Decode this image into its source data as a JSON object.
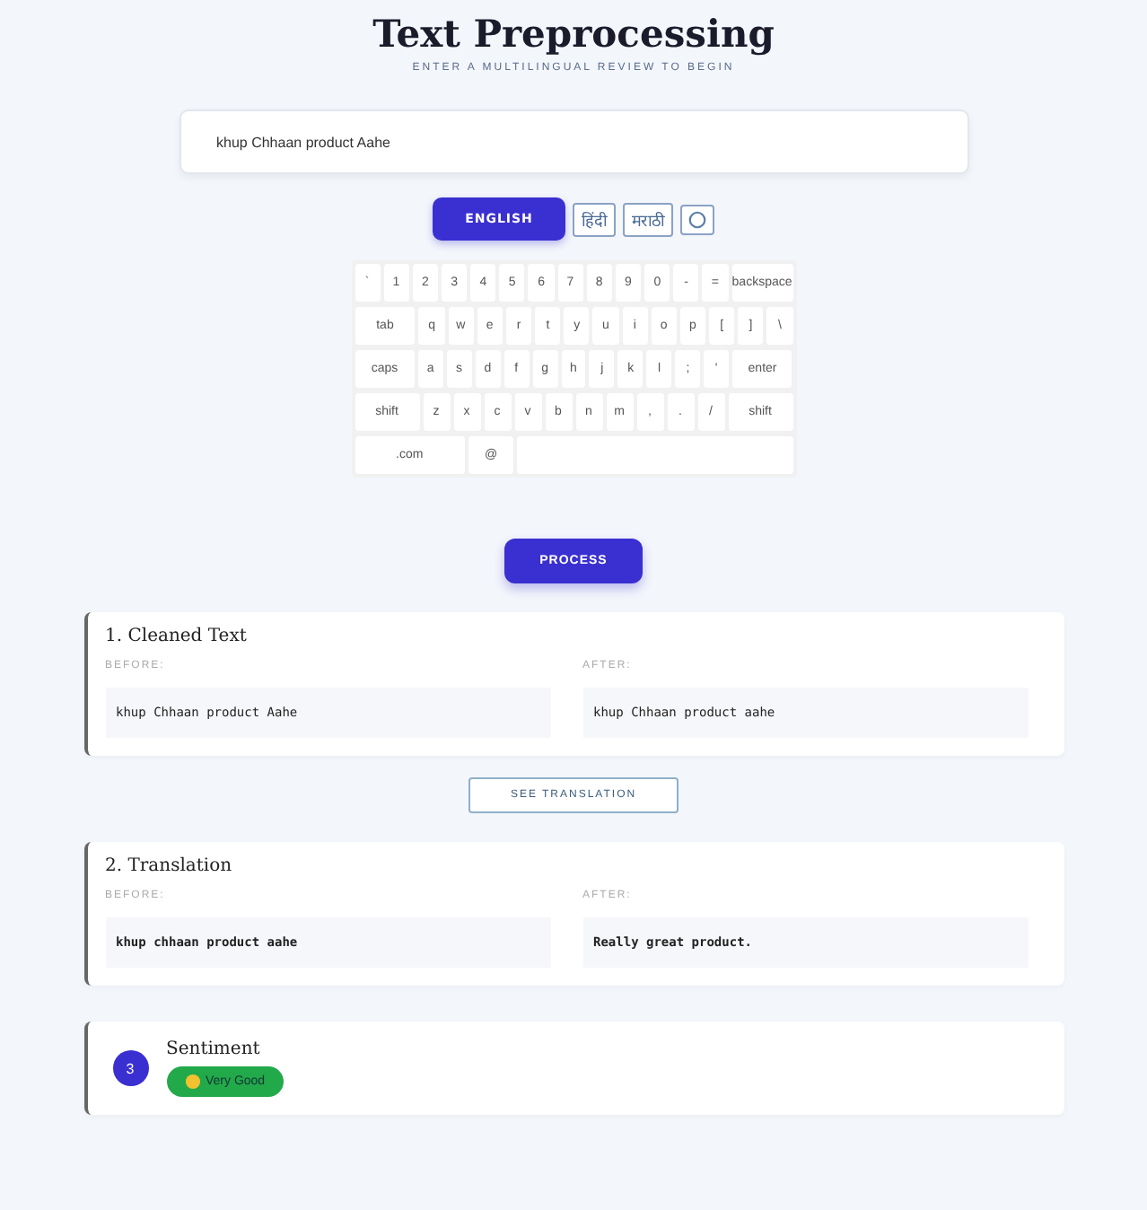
{
  "header": {
    "title": "Text Preprocessing",
    "subtitle": "ENTER A MULTILINGUAL REVIEW TO BEGIN"
  },
  "input": {
    "value": "khup Chhaan product Aahe"
  },
  "languages": [
    {
      "label": "ENGLISH",
      "selected": true
    },
    {
      "label": "हिंदी",
      "selected": false
    },
    {
      "label": "मराठी",
      "selected": false
    }
  ],
  "keyboard": {
    "rows": [
      {
        "keys": [
          "`",
          "1",
          "2",
          "3",
          "4",
          "5",
          "6",
          "7",
          "8",
          "9",
          "0",
          "-",
          "=",
          "backspace"
        ]
      },
      {
        "keys": [
          "tab",
          "q",
          "w",
          "e",
          "r",
          "t",
          "y",
          "u",
          "i",
          "o",
          "p",
          "[",
          "]",
          "\\"
        ]
      },
      {
        "keys": [
          "caps",
          "a",
          "s",
          "d",
          "f",
          "g",
          "h",
          "j",
          "k",
          "l",
          ";",
          "'",
          "enter"
        ]
      },
      {
        "keys": [
          "shift",
          "z",
          "x",
          "c",
          "v",
          "b",
          "n",
          "m",
          ",",
          ".",
          "/",
          "shift"
        ]
      },
      {
        "keys": [
          ".com",
          "@"
        ]
      }
    ]
  },
  "process_button": "PROCESS",
  "cleaned": {
    "title": "1. Cleaned Text",
    "before_label": "BEFORE:",
    "before": "khup Chhaan product Aahe",
    "after_label": "AFTER:",
    "after": "khup Chhaan product aahe"
  },
  "translation_button": "SEE TRANSLATION",
  "translation": {
    "title": "2. Translation",
    "before_label": "BEFORE:",
    "before": "khup chhaan product aahe",
    "after_label": "AFTER:",
    "after": "Really great product."
  },
  "sentiment": {
    "badge_number": "3",
    "title": "Sentiment",
    "label": "Very Good",
    "color": "#22a94a"
  }
}
